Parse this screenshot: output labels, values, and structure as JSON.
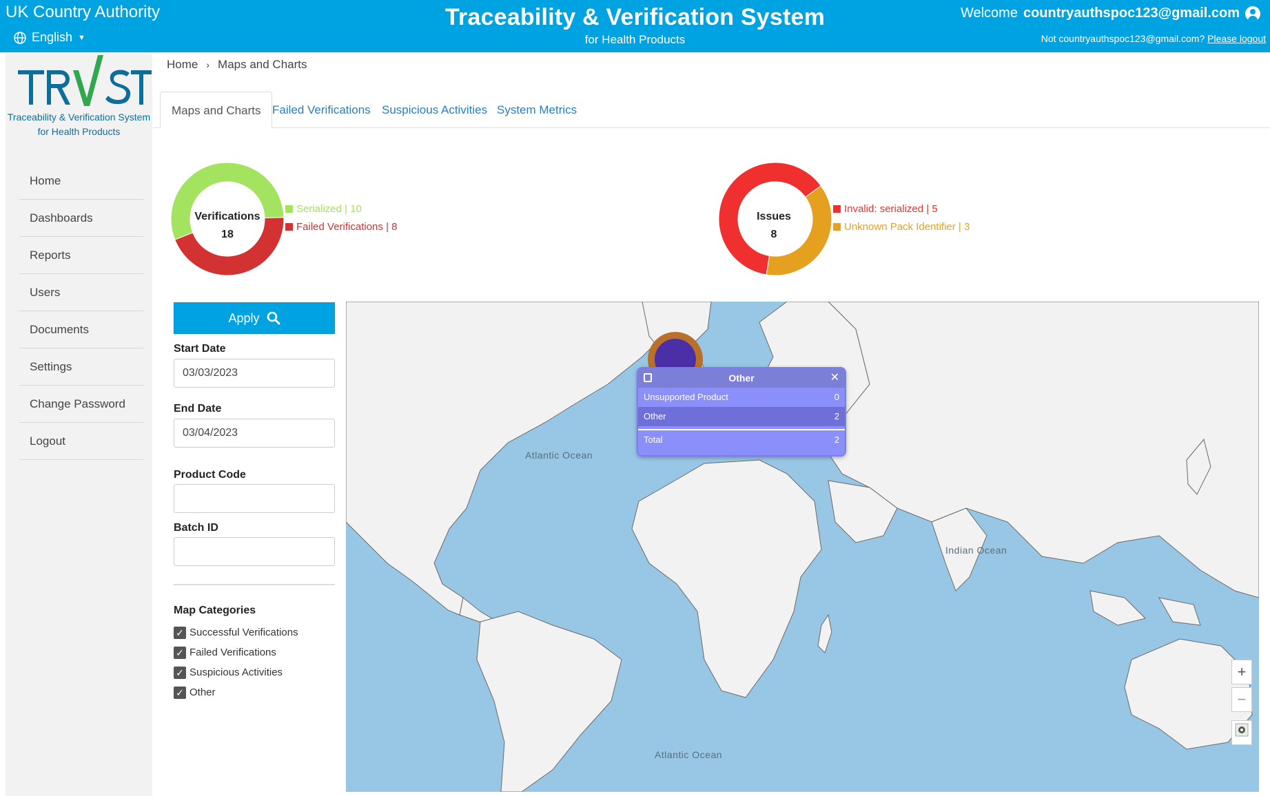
{
  "header": {
    "org_name": "UK Country Authority",
    "language": "English",
    "title": "Traceability & Verification System",
    "subtitle": "for Health Products",
    "welcome_label": "Welcome",
    "user_email": "countryauthspoc123@gmail.com",
    "not_user_text": "Not countryauthspoc123@gmail.com?",
    "logout_link": "Please logout"
  },
  "logo": {
    "text": "TRVST",
    "tagline_1": "Traceability & Verification System",
    "tagline_2": "for Health Products"
  },
  "sidebar": {
    "items": [
      {
        "label": "Home"
      },
      {
        "label": "Dashboards"
      },
      {
        "label": "Reports"
      },
      {
        "label": "Users"
      },
      {
        "label": "Documents"
      },
      {
        "label": "Settings"
      },
      {
        "label": "Change Password"
      },
      {
        "label": "Logout"
      }
    ]
  },
  "breadcrumb": {
    "home": "Home",
    "current": "Maps and Charts"
  },
  "tabs": [
    {
      "label": "Maps and Charts",
      "active": true
    },
    {
      "label": "Failed Verifications",
      "active": false
    },
    {
      "label": "Suspicious Activities",
      "active": false
    },
    {
      "label": "System Metrics",
      "active": false
    }
  ],
  "chart_data": [
    {
      "type": "pie",
      "center_title": "Verifications",
      "center_value": "18",
      "series": [
        {
          "name": "Serialized",
          "value": 10,
          "color": "#a3e35f",
          "label": "Serialized | 10"
        },
        {
          "name": "Failed Verifications",
          "value": 8,
          "color": "#d23232",
          "label": "Failed Verifications | 8"
        }
      ]
    },
    {
      "type": "pie",
      "center_title": "Issues",
      "center_value": "8",
      "series": [
        {
          "name": "Invalid: serialized",
          "value": 5,
          "color": "#f0302f",
          "label": "Invalid: serialized | 5"
        },
        {
          "name": "Unknown Pack Identifier",
          "value": 3,
          "color": "#e5a020",
          "label": "Unknown Pack Identifier | 3"
        }
      ]
    }
  ],
  "filters": {
    "apply_label": "Apply",
    "start_date_label": "Start Date",
    "start_date_value": "03/03/2023",
    "end_date_label": "End Date",
    "end_date_value": "03/04/2023",
    "product_code_label": "Product Code",
    "product_code_value": "",
    "batch_id_label": "Batch ID",
    "batch_id_value": "",
    "categories_title": "Map Categories",
    "categories": [
      {
        "label": "Successful Verifications",
        "checked": true
      },
      {
        "label": "Failed Verifications",
        "checked": true
      },
      {
        "label": "Suspicious Activities",
        "checked": true
      },
      {
        "label": "Other",
        "checked": true
      }
    ]
  },
  "map": {
    "ocean_labels": {
      "atlantic_north": "Atlantic Ocean",
      "indian": "Indian Ocean",
      "atlantic_south": "Atlantic Ocean"
    },
    "zoom_in": "+",
    "zoom_out": "−",
    "popup": {
      "title": "Other",
      "rows": [
        {
          "label": "Unsupported Product",
          "value": "0"
        },
        {
          "label": "Other",
          "value": "2"
        }
      ],
      "total_label": "Total",
      "total_value": "2"
    }
  },
  "colors": {
    "brand": "#00a3e2",
    "link": "#2a7dbf",
    "ocean": "#98c6e5",
    "land": "#f2f2f2",
    "popup": "#8a8ffb"
  }
}
